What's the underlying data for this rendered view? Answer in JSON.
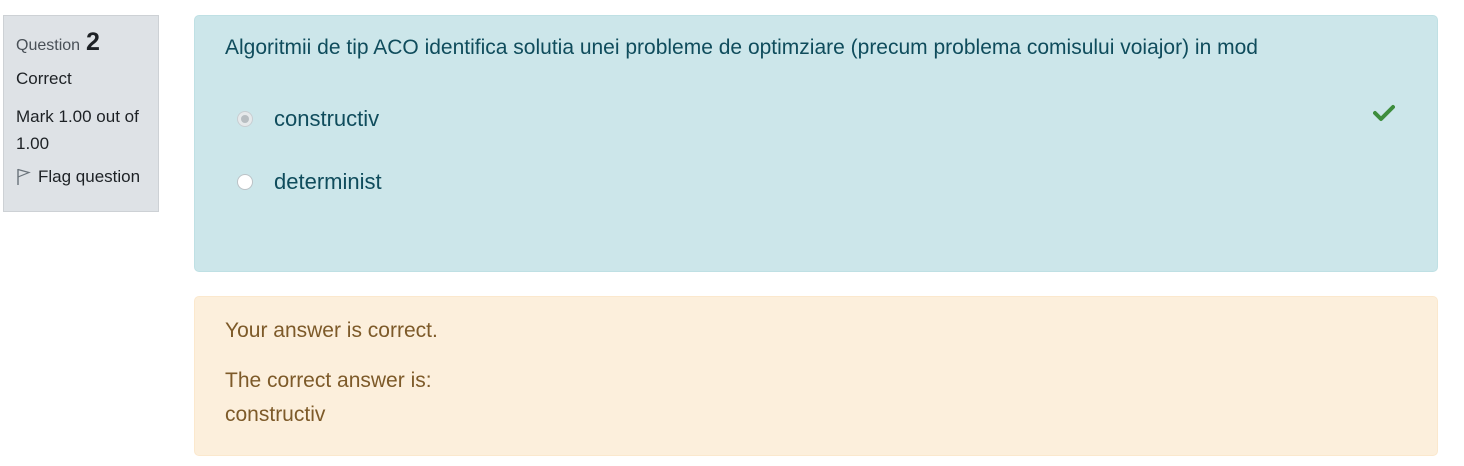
{
  "info": {
    "question_word": "Question",
    "question_number": "2",
    "state": "Correct",
    "grade": "Mark 1.00 out of 1.00",
    "flag_label": "Flag question"
  },
  "question": {
    "text": "Algoritmii de tip ACO identifica solutia unei probleme de optimziare (precum problema comisului voiajor) in mod",
    "options": [
      {
        "label": "constructiv",
        "selected": true,
        "correct": true
      },
      {
        "label": "determinist",
        "selected": false,
        "correct": false
      }
    ]
  },
  "outcome": {
    "feedback": "Your answer is correct.",
    "right_answer_prefix": "The correct answer is:",
    "right_answer_value": "constructiv"
  },
  "colors": {
    "formulation_bg": "#cce6ea",
    "outcome_bg": "#fcefdc",
    "info_bg": "#dee2e6",
    "correct_check": "#3d8d3d"
  },
  "icons": {
    "flag": "flag-outline-icon",
    "correct": "check-icon"
  }
}
